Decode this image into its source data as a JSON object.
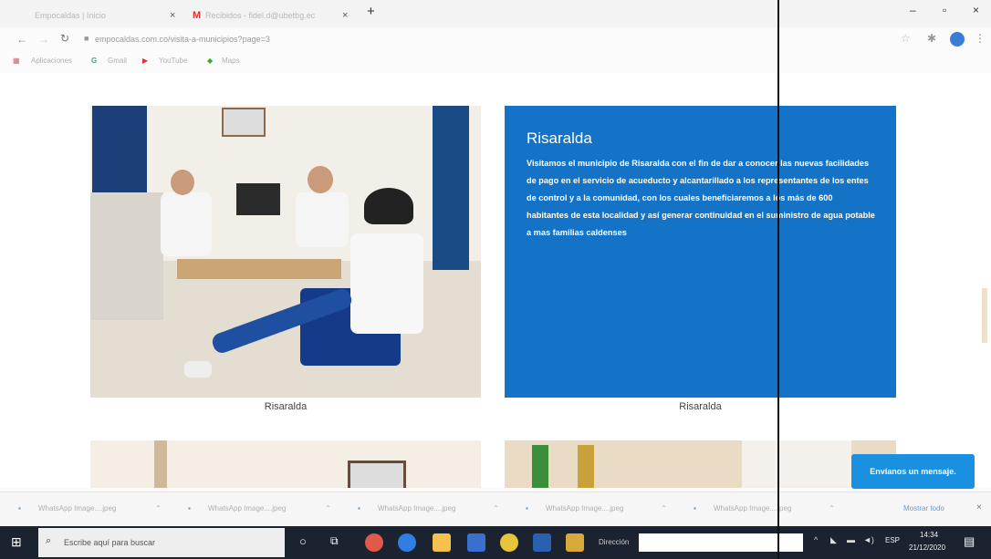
{
  "browser": {
    "tabs": [
      {
        "label": "Empocaldas | Inicio",
        "icon": "page-icon"
      },
      {
        "label": "Recibidos - fidel.d@ubetbg.ec",
        "icon": "gmail-icon"
      }
    ],
    "new_tab": "+",
    "url": "empocaldas.com.co/visita-a-municipios?page=3",
    "bookmarks": [
      "Aplicaciones",
      "Gmail",
      "YouTube",
      "Maps"
    ]
  },
  "page": {
    "left_card": {
      "caption": "Risaralda"
    },
    "right_card": {
      "title": "Risaralda",
      "text": "Visitamos el municipio de Risaralda con el fin de dar a conocer las nuevas facilidades de pago en el servicio de acueducto y alcantarillado a los representantes de los entes de control y a la comunidad, con los cuales beneficiaremos a los más de 600 habitantes de esta localidad y así generar continuidad en el suministro de agua potable a mas familias caldenses",
      "caption": "Risaralda"
    },
    "chat_button": "Envíanos un mensaje."
  },
  "downloads": {
    "items": [
      "WhatsApp Image....jpeg",
      "WhatsApp Image....jpeg",
      "WhatsApp Image....jpeg",
      "WhatsApp Image....jpeg",
      "WhatsApp Image....jpeg"
    ],
    "show_all": "Mostrar todo"
  },
  "taskbar": {
    "search_placeholder": "Escribe aquí para buscar",
    "address_label": "Dirección",
    "language": "ESP",
    "time": "14:34",
    "date": "21/12/2020"
  },
  "colors": {
    "accent_blue": "#1473c7",
    "chat_blue": "#1a90e0",
    "taskbar": "#1b2330"
  }
}
